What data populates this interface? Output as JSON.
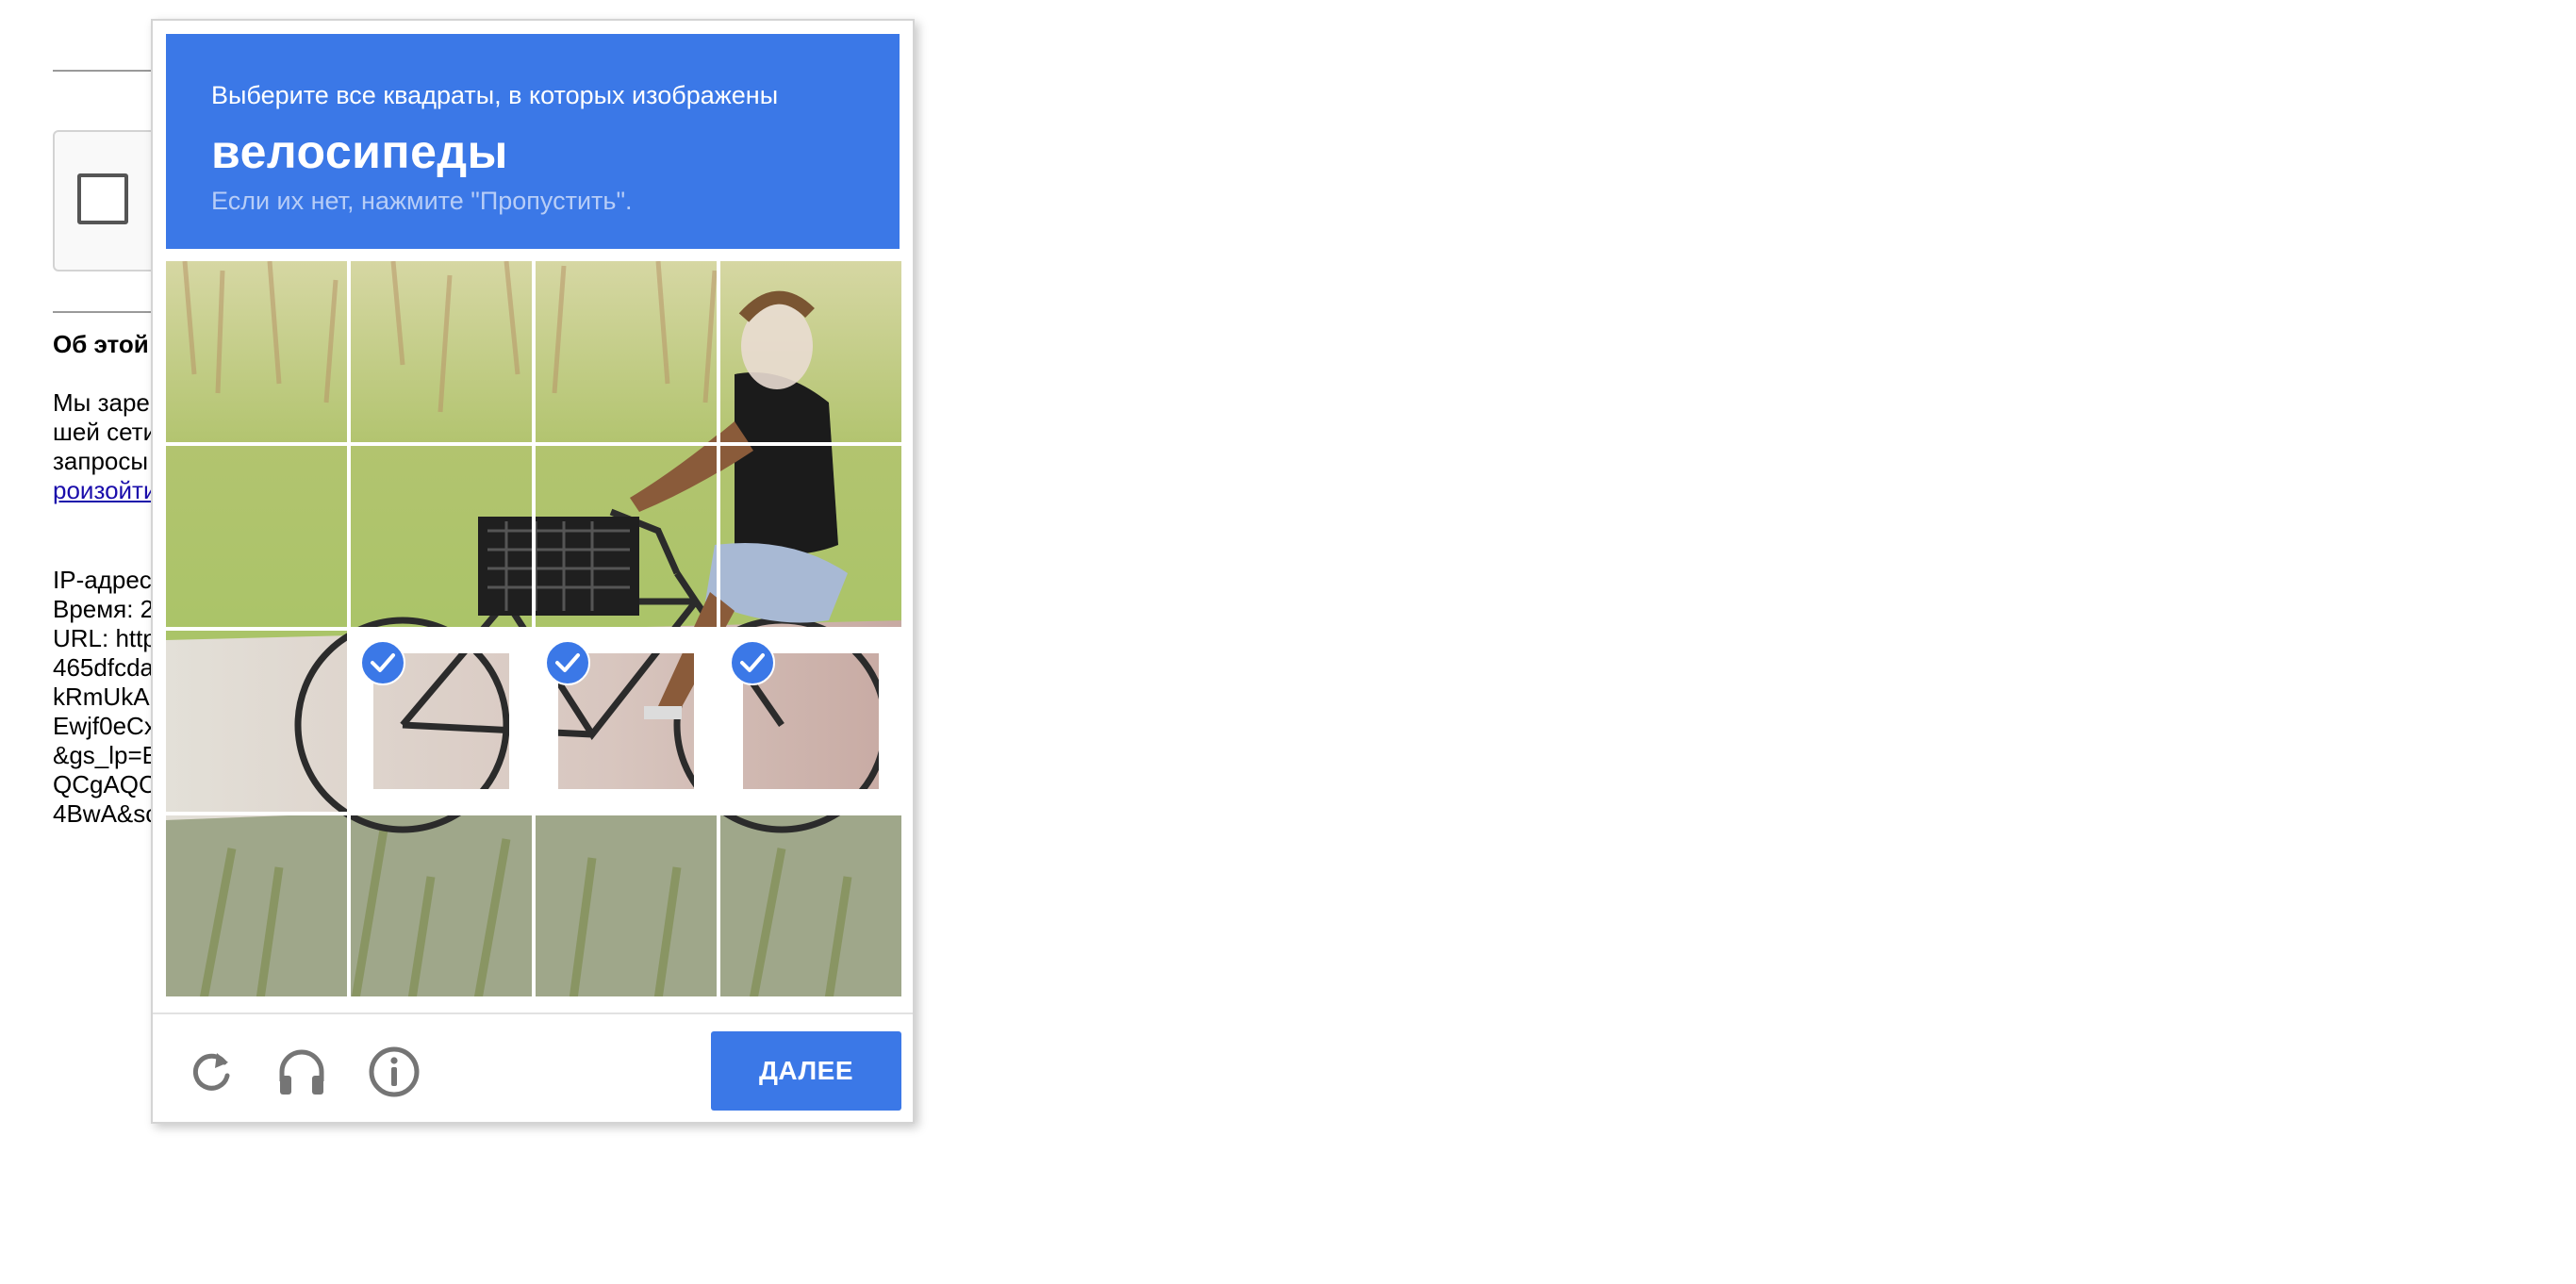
{
  "background_page": {
    "about_heading": "Об этой",
    "info_lines": [
      "Мы заре",
      "шей сети",
      "запросы"
    ],
    "info_link": "роизойти",
    "meta_lines": [
      "IP-адрес",
      "Время: 2",
      "URL: http",
      "465dfcda",
      "kRmUkA",
      "Ewjf0eCx",
      "&gs_lp=E",
      "QCgAQC",
      "4BwA&sc"
    ]
  },
  "captcha": {
    "prompt": "Выберите все квадраты, в которых изображены",
    "target": "велосипеды",
    "hint": "Если их нет, нажмите \"Пропустить\".",
    "grid": {
      "rows": 4,
      "columns": 4,
      "selected_tiles": [
        9,
        10,
        11
      ]
    },
    "footer": {
      "reload_icon": "reload-icon",
      "audio_icon": "headphones-icon",
      "info_icon": "info-icon",
      "next_label": "ДАЛЕЕ"
    },
    "colors": {
      "accent": "#3b78e7",
      "icon_gray": "#757575"
    }
  }
}
